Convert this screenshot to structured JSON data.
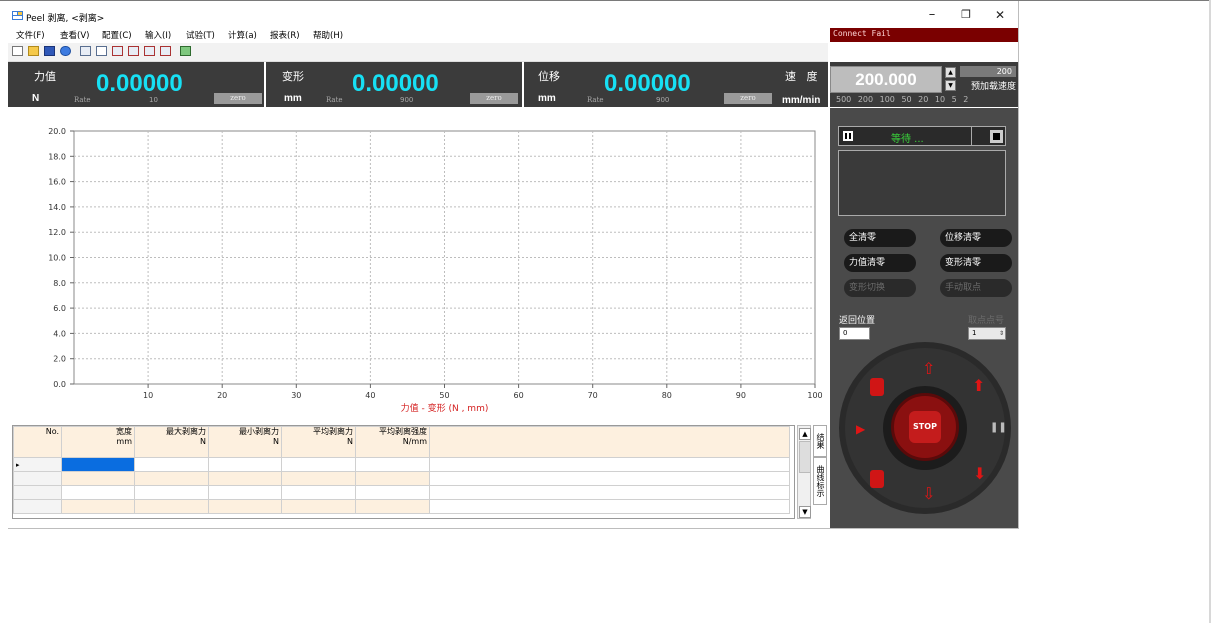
{
  "window": {
    "title": "Peel 剥离, <剥离>",
    "controls": {
      "minimize": "–",
      "maximize": "❐",
      "close": "✕"
    }
  },
  "menu": [
    "文件(F)",
    "查看(V)",
    "配置(C)",
    "输入(I)",
    "试验(T)",
    "计算(a)",
    "报表(R)",
    "帮助(H)"
  ],
  "toolbar_icons": [
    "new-icon",
    "open-icon",
    "save-icon",
    "help-icon",
    "grid-icon",
    "rect-icon",
    "curve-icon",
    "curve2-icon",
    "chart-a-icon",
    "chart-b-icon",
    "photo-icon"
  ],
  "connection": {
    "status": "Connect Fail"
  },
  "readouts": [
    {
      "label": "力值",
      "value": "0.00000",
      "unit": "N",
      "rate_label": "Rate",
      "rate": "10",
      "zero": "zero"
    },
    {
      "label": "变形",
      "value": "0.00000",
      "unit": "mm",
      "rate_label": "Rate",
      "rate": "900",
      "zero": "zero"
    },
    {
      "label": "位移",
      "value": "0.00000",
      "unit": "mm",
      "rate_label": "Rate",
      "rate": "900",
      "zero": "zero"
    }
  ],
  "speed": {
    "label": "速   度",
    "unit": "mm/min",
    "value": "200.000",
    "preload_value": "200",
    "preload_label": "预加载速度",
    "presets": "500 200 100 50 20 10 5 2"
  },
  "chart_data": {
    "type": "line",
    "xlabel": "力值 - 变形   (N , mm)",
    "ylabel": "",
    "xlim": [
      0,
      100
    ],
    "ylim": [
      0,
      20
    ],
    "x_ticks": [
      "10",
      "20",
      "30",
      "40",
      "50",
      "60",
      "70",
      "80",
      "90",
      "100"
    ],
    "y_ticks": [
      "0.0",
      "2.0",
      "4.0",
      "6.0",
      "8.0",
      "10.0",
      "12.0",
      "14.0",
      "16.0",
      "18.0",
      "20.0"
    ],
    "grid": true,
    "series": []
  },
  "table": {
    "columns": [
      {
        "title": "No.",
        "sub": ""
      },
      {
        "title": "宽度",
        "sub": "mm"
      },
      {
        "title": "最大剥离力",
        "sub": "N"
      },
      {
        "title": "最小剥离力",
        "sub": "N"
      },
      {
        "title": "平均剥离力",
        "sub": "N"
      },
      {
        "title": "平均剥离强度",
        "sub": "N/mm"
      }
    ],
    "row_indicator": "▸"
  },
  "side_tabs": {
    "result": "结果",
    "curve": "曲线标示"
  },
  "control": {
    "status": "等待 ...",
    "buttons": {
      "clear_all": "全清零",
      "clear_disp": "位移清零",
      "clear_force": "力值清零",
      "clear_deform": "变形清零",
      "deform_switch": "变形切换",
      "manual_pick": "手动取点"
    },
    "return_label": "返回位置",
    "return_value": "0",
    "pick_label": "取点点号",
    "pick_value": "1",
    "stop": "STOP"
  }
}
